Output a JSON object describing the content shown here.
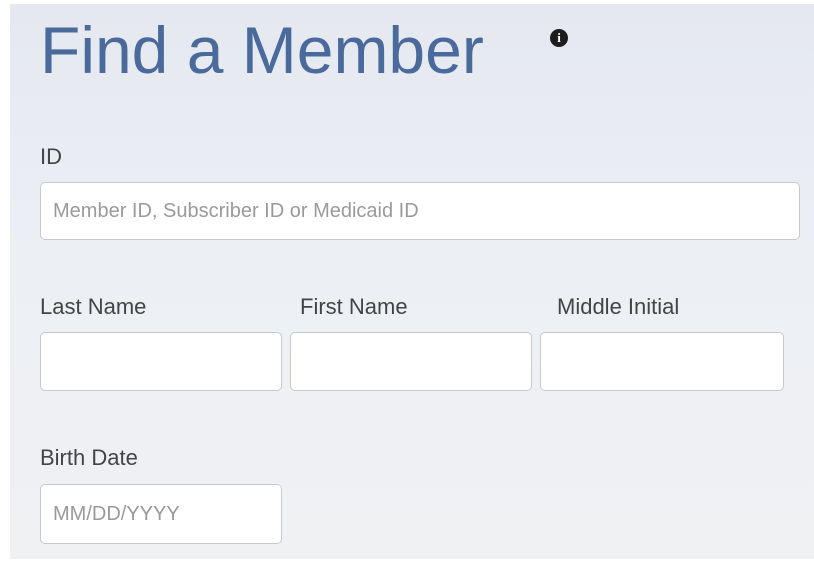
{
  "form": {
    "title": "Find a Member",
    "info_icon": "info-icon",
    "info_glyph": "i",
    "id_label": "ID",
    "id_placeholder": "Member ID, Subscriber ID or Medicaid ID",
    "id_value": "",
    "last_name_label": "Last Name",
    "last_name_value": "",
    "first_name_label": "First Name",
    "first_name_value": "",
    "middle_initial_label": "Middle Initial",
    "middle_initial_value": "",
    "birth_date_label": "Birth Date",
    "birth_date_placeholder": "MM/DD/YYYY",
    "birth_date_value": ""
  },
  "colors": {
    "title": "#4a6a9c",
    "label": "#444444",
    "placeholder": "#9a9a9a",
    "input_border": "#c7c9cc"
  }
}
